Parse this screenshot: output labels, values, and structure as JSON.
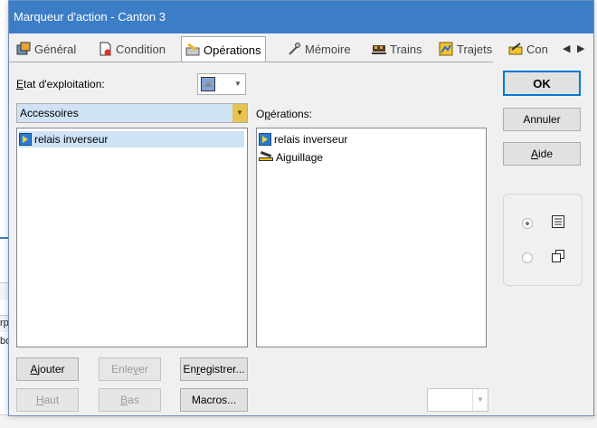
{
  "background": {
    "left_texts": [
      "rp",
      "bo"
    ]
  },
  "window": {
    "title": "Marqueur d'action - Canton 3"
  },
  "tabs": [
    {
      "label": "Général",
      "icon": "general-icon",
      "active": false
    },
    {
      "label": "Condition",
      "icon": "condition-icon",
      "active": false
    },
    {
      "label": "Opérations",
      "icon": "operations-icon",
      "active": true
    },
    {
      "label": "Mémoire",
      "icon": "memory-icon",
      "active": false
    },
    {
      "label": "Trains",
      "icon": "trains-icon",
      "active": false
    },
    {
      "label": "Trajets",
      "icon": "routes-icon",
      "active": false
    },
    {
      "label": "Con",
      "icon": "con-icon",
      "active": false
    }
  ],
  "left": {
    "status_label": "Etat d'exploitation:",
    "status_label_mnemonic": "E",
    "status_label_rest": "tat d'exploitation:",
    "combo_value": "Accessoires",
    "items": [
      {
        "label": "relais inverseur",
        "icon": "relay-icon",
        "selected": true
      }
    ]
  },
  "right": {
    "operations_label_pre": "O",
    "operations_label_mnemonic": "p",
    "operations_label_post": "érations:",
    "items": [
      {
        "label": "relais inverseur",
        "icon": "relay-icon"
      },
      {
        "label": "Aiguillage",
        "icon": "switch-icon"
      }
    ]
  },
  "buttons": {
    "ok": "OK",
    "annuler": "Annuler",
    "aide_mn": "A",
    "aide_rest": "ide",
    "ajouter_mn": "A",
    "ajouter_rest": "jouter",
    "enlever_pre": "Enle",
    "enlever_mn": "v",
    "enlever_post": "er",
    "enregistrer_pre": "En",
    "enregistrer_mn": "r",
    "enregistrer_post": "egistrer...",
    "haut_mn": "H",
    "haut_rest": "aut",
    "bas_mn": "B",
    "bas_rest": "as",
    "macros": "Macros..."
  },
  "view_mode": {
    "selected": "list",
    "options": [
      "list",
      "copy"
    ]
  },
  "colors": {
    "titlebar": "#3c7ec6",
    "selection": "#cde4f7",
    "ok_border": "#0078d7"
  }
}
